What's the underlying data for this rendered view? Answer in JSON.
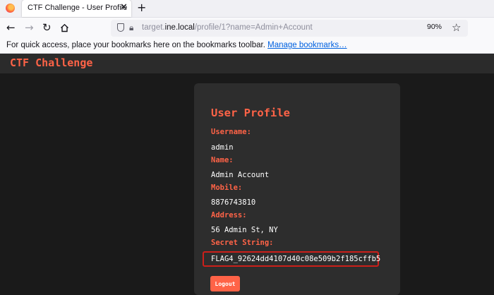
{
  "browser": {
    "tab_title": "CTF Challenge - User Profile",
    "tab_close": "✕",
    "new_tab": "+",
    "url": {
      "prefix": "target.",
      "domain": "ine.local",
      "path": "/profile/1?name=Admin+Account"
    },
    "zoom": "90%",
    "bookmarks_text": "For quick access, place your bookmarks here on the bookmarks toolbar.",
    "bookmarks_link": "Manage bookmarks…"
  },
  "site": {
    "title": "CTF Challenge"
  },
  "profile": {
    "heading": "User Profile",
    "fields": [
      {
        "label": "Username:",
        "value": "admin"
      },
      {
        "label": "Name:",
        "value": "Admin Account"
      },
      {
        "label": "Mobile:",
        "value": "8876743810"
      },
      {
        "label": "Address:",
        "value": "56 Admin St, NY"
      },
      {
        "label": "Secret String:",
        "value": "FLAG4_92624dd4107d40c08e509b2f185cffb5"
      }
    ],
    "logout_label": "Logout"
  },
  "colors": {
    "accent": "#ff6347",
    "highlight_border": "#cc1f1a",
    "page_background": "#1a1a1a",
    "card_background": "#2d2d2d"
  }
}
